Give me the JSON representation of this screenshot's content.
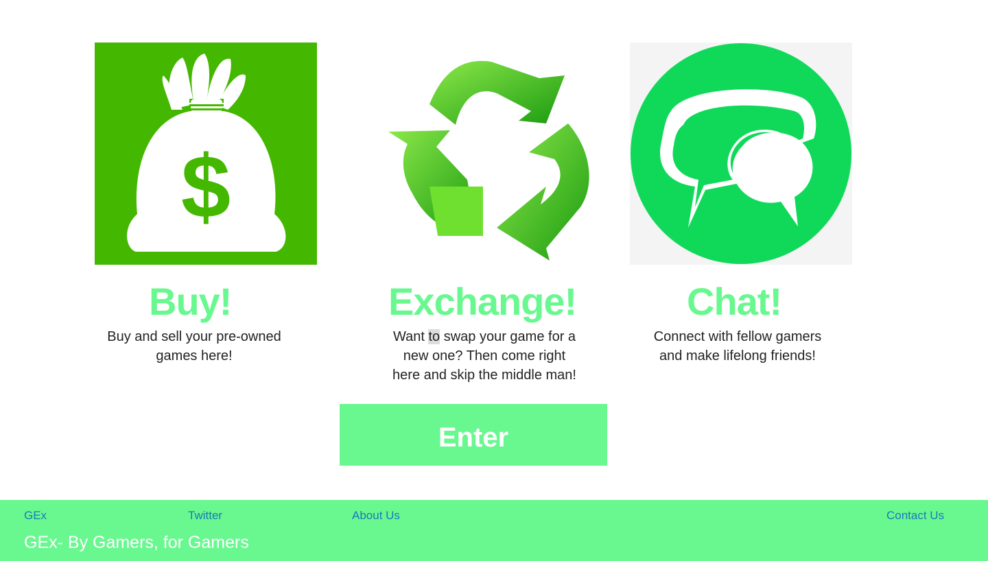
{
  "features": [
    {
      "title": "Buy!",
      "description": "Buy and sell your pre-owned games here!",
      "icon": "money-bag-icon"
    },
    {
      "title": "Exchange!",
      "description_parts": [
        "Want ",
        "to",
        " swap your game for a new one? Then come right here and skip the middle man!"
      ],
      "icon": "recycle-icon"
    },
    {
      "title": "Chat!",
      "description": "Connect with fellow gamers and make lifelong friends!",
      "icon": "chat-bubbles-icon"
    }
  ],
  "enter_label": "Enter",
  "footer": {
    "links": [
      "GEx",
      "Twitter",
      "About Us",
      "Contact Us"
    ],
    "tagline": "GEx- By Gamers, for Gamers"
  },
  "colors": {
    "accent": "#69f88f",
    "link": "#1a7ab8",
    "money_bg": "#44b800",
    "chat_green": "#10d95a"
  }
}
